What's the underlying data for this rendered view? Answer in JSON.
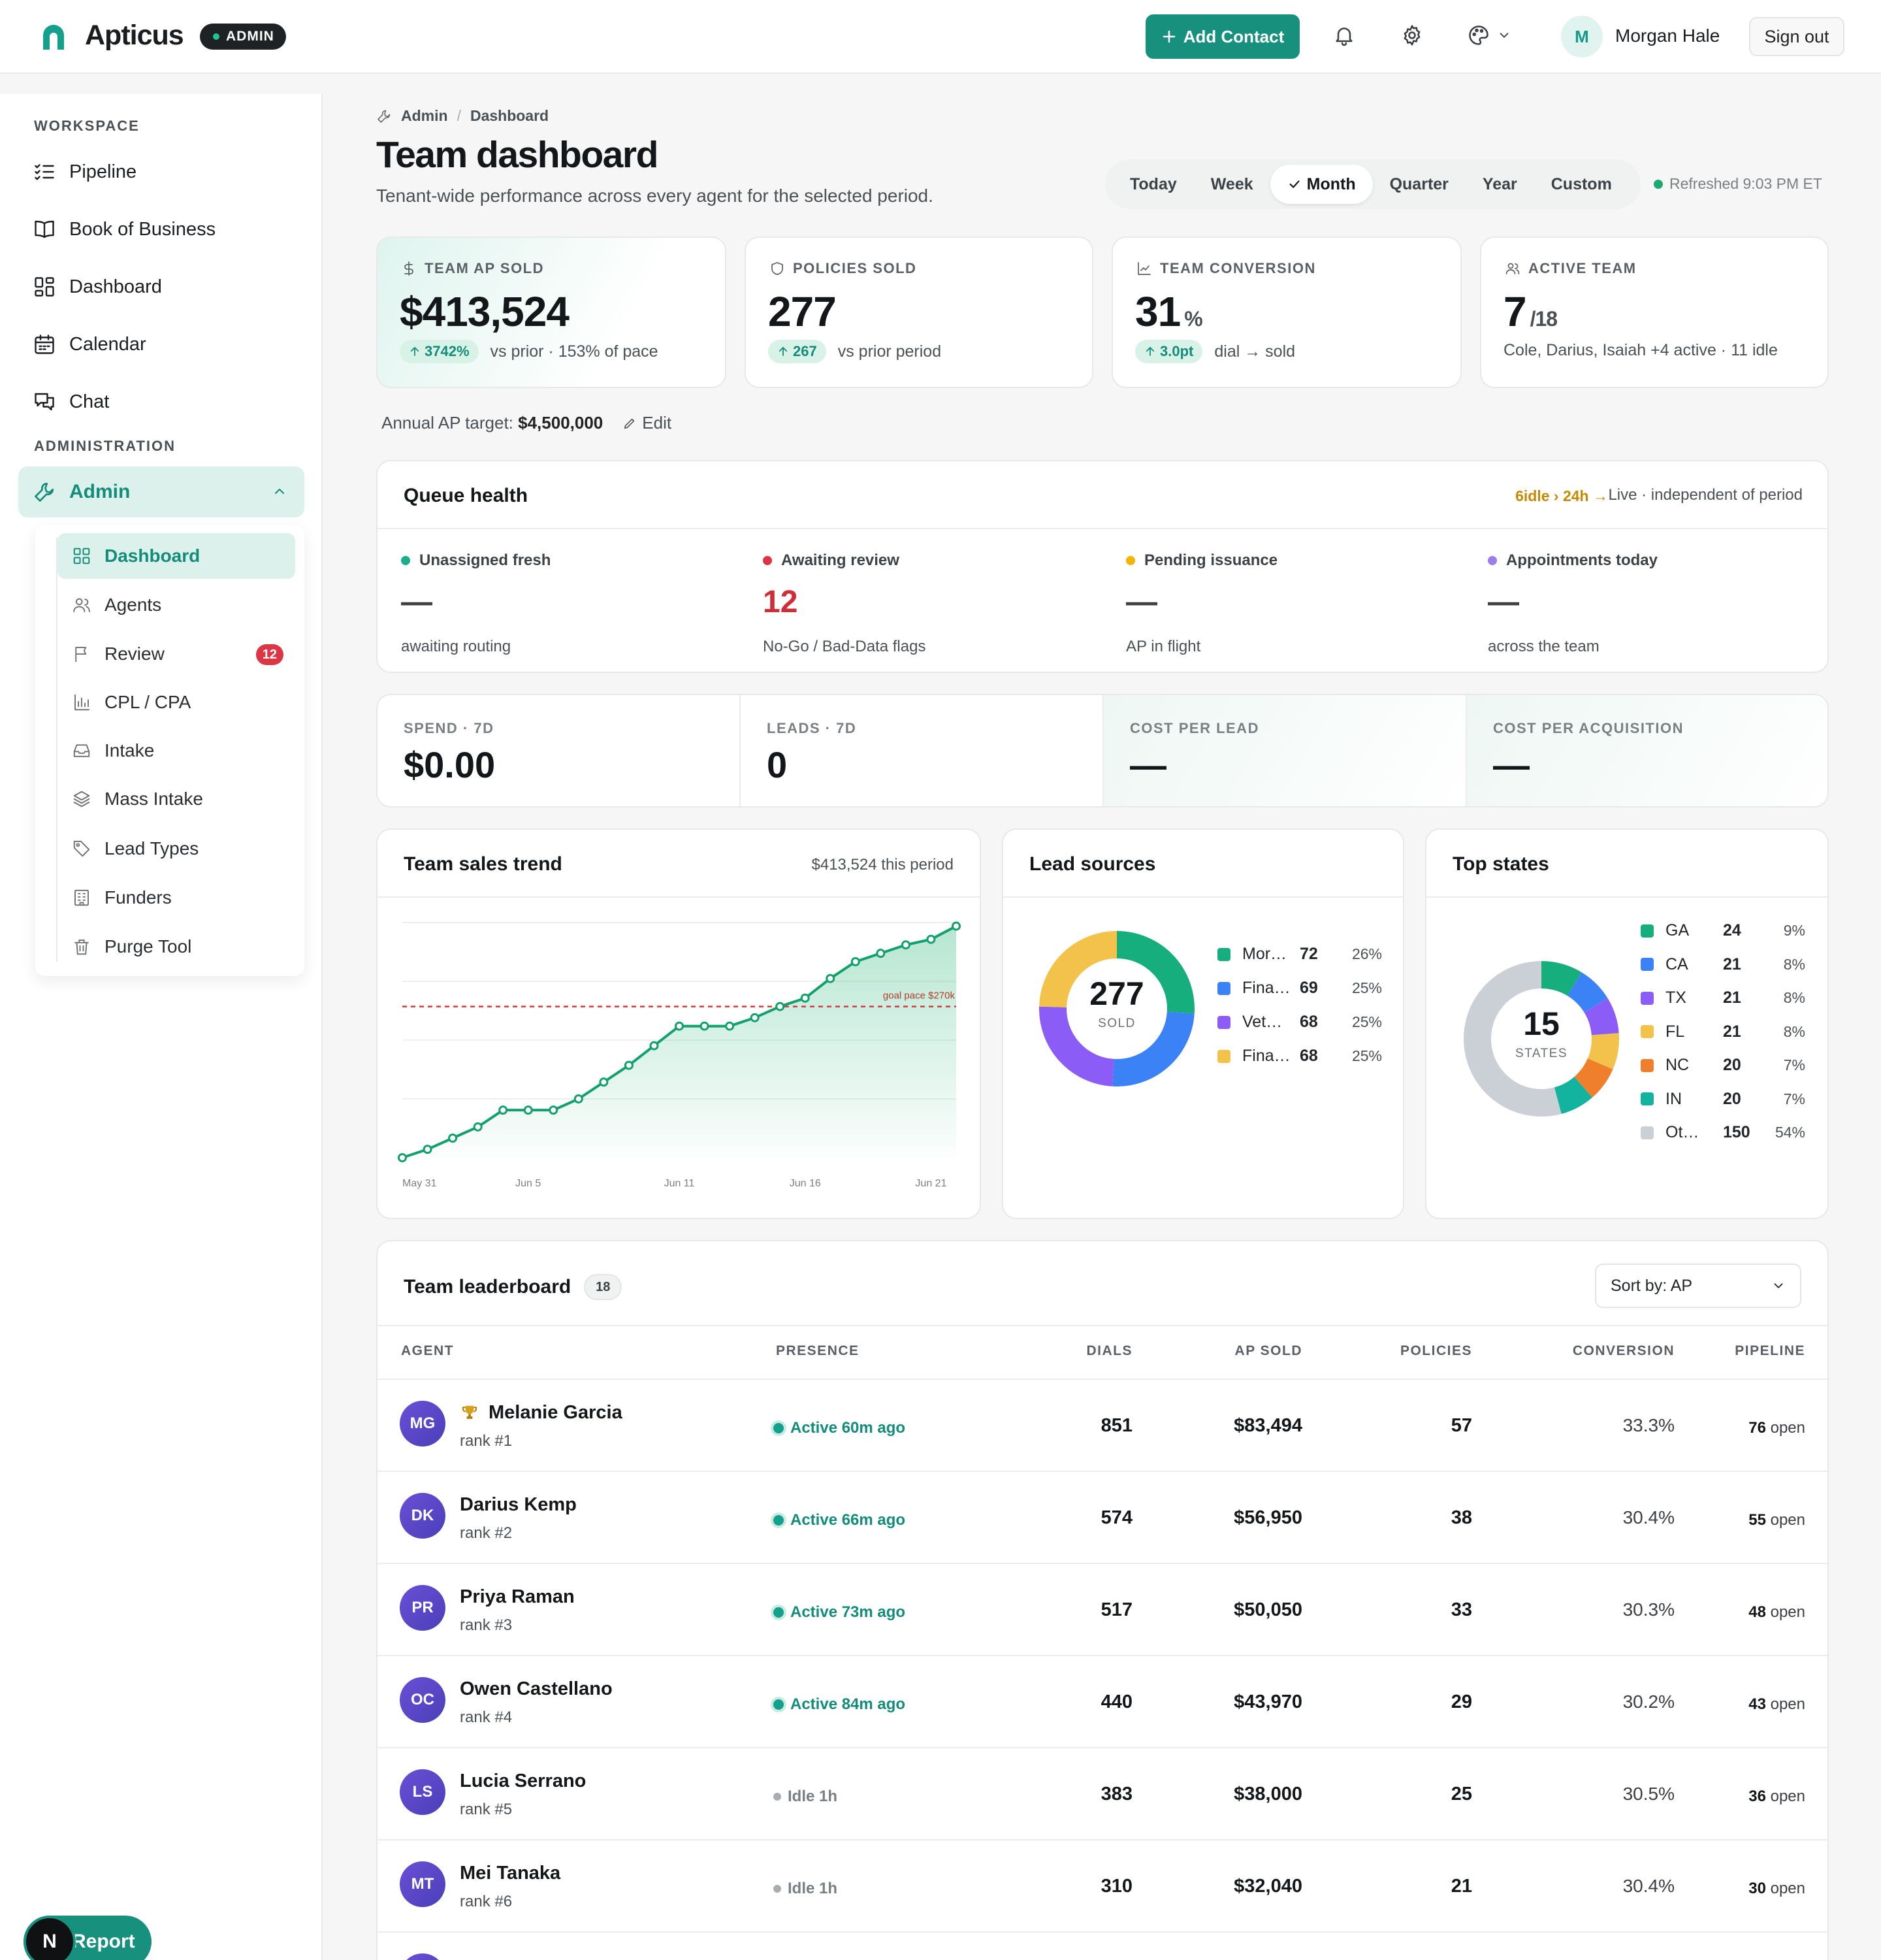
{
  "header": {
    "app_name": "Apticus",
    "role_badge": "ADMIN",
    "add_contact": "Add Contact",
    "user_initial": "M",
    "user_name": "Morgan Hale",
    "sign_out": "Sign out",
    "icons": [
      "bell-icon",
      "gear-icon",
      "palette-icon",
      "chevron-down-icon"
    ]
  },
  "sidebar": {
    "workspace_label": "WORKSPACE",
    "workspace_items": [
      {
        "label": "Pipeline",
        "icon": "list-check-icon"
      },
      {
        "label": "Book of Business",
        "icon": "book-icon"
      },
      {
        "label": "Dashboard",
        "icon": "grid-icon"
      },
      {
        "label": "Calendar",
        "icon": "calendar-icon"
      },
      {
        "label": "Chat",
        "icon": "chat-icon"
      }
    ],
    "admin_label": "ADMINISTRATION",
    "admin_item": "Admin",
    "admin_items": [
      {
        "label": "Dashboard",
        "icon": "grid-icon",
        "active": true
      },
      {
        "label": "Agents",
        "icon": "users-icon"
      },
      {
        "label": "Review",
        "icon": "flag-icon",
        "badge": "12"
      },
      {
        "label": "CPL / CPA",
        "icon": "bar-chart-icon"
      },
      {
        "label": "Intake",
        "icon": "inbox-icon"
      },
      {
        "label": "Mass Intake",
        "icon": "layers-icon"
      },
      {
        "label": "Lead Types",
        "icon": "tag-icon"
      },
      {
        "label": "Funders",
        "icon": "building-icon"
      },
      {
        "label": "Purge Tool",
        "icon": "trash-icon"
      }
    ],
    "report_initial": "N",
    "report_label": "Report"
  },
  "page": {
    "breadcrumb": [
      "Admin",
      "Dashboard"
    ],
    "title": "Team dashboard",
    "subtitle": "Tenant-wide performance across every agent for the selected period.",
    "periods": [
      "Today",
      "Week",
      "Month",
      "Quarter",
      "Year",
      "Custom"
    ],
    "active_period": "Month",
    "refreshed": "Refreshed 9:03 PM ET"
  },
  "kpis": [
    {
      "label": "TEAM AP SOLD",
      "icon": "dollar-icon",
      "value": "$413,524",
      "delta": "3742%",
      "note": "vs prior · 153% of pace"
    },
    {
      "label": "POLICIES SOLD",
      "icon": "shield-icon",
      "value": "277",
      "delta": "267",
      "note": "vs prior period"
    },
    {
      "label": "TEAM CONVERSION",
      "icon": "line-chart-icon",
      "value": "31",
      "unit": "%",
      "delta": "3.0pt",
      "note": "dial → sold"
    },
    {
      "label": "ACTIVE TEAM",
      "icon": "users-icon",
      "value": "7",
      "unit": "/18",
      "note": "Cole, Darius, Isaiah +4 active · 11 idle"
    }
  ],
  "target": {
    "prefix": "Annual AP target:",
    "value": "$4,500,000",
    "edit": "Edit"
  },
  "queue": {
    "title": "Queue health",
    "warning": "6idle › 24h →",
    "live_note": "Live · independent of period",
    "items": [
      {
        "label": "Unassigned fresh",
        "dot": "#1aae8a",
        "value": "—",
        "sub": "awaiting routing"
      },
      {
        "label": "Awaiting review",
        "dot": "#dc3545",
        "value": "12",
        "value_color": "#cf2e38",
        "sub": "No-Go / Bad-Data flags"
      },
      {
        "label": "Pending issuance",
        "dot": "#f4b400",
        "value": "—",
        "sub": "AP in flight"
      },
      {
        "label": "Appointments today",
        "dot": "#9b7df0",
        "value": "—",
        "sub": "across the team"
      }
    ]
  },
  "spend": [
    {
      "label": "SPEND · 7D",
      "value": "$0.00"
    },
    {
      "label": "LEADS · 7D",
      "value": "0"
    },
    {
      "label": "COST PER LEAD",
      "value": "—"
    },
    {
      "label": "COST PER ACQUISITION",
      "value": "—"
    }
  ],
  "sales_trend": {
    "title": "Team sales trend",
    "total_note": "$413,524 this period",
    "goal_label": "goal pace $270k"
  },
  "lead_sources": {
    "title": "Lead sources",
    "center_value": "277",
    "center_label": "SOLD"
  },
  "top_states": {
    "title": "Top states",
    "center_value": "15",
    "center_label": "STATES"
  },
  "chart_data": [
    {
      "type": "area",
      "x": [
        "May 31",
        "Jun 1",
        "Jun 2",
        "Jun 3",
        "Jun 4",
        "Jun 5",
        "Jun 6",
        "Jun 7",
        "Jun 8",
        "Jun 9",
        "Jun 10",
        "Jun 11",
        "Jun 12",
        "Jun 13",
        "Jun 14",
        "Jun 15",
        "Jun 16",
        "Jun 17",
        "Jun 18",
        "Jun 19",
        "Jun 20",
        "Jun 21",
        "Jun 22"
      ],
      "x_tick_labels": [
        "May 31",
        "Jun 5",
        "Jun 11",
        "Jun 16",
        "Jun 21"
      ],
      "values": [
        0,
        15000,
        35000,
        55000,
        85000,
        85000,
        85000,
        105000,
        135000,
        165000,
        200000,
        235000,
        235000,
        235000,
        250000,
        270000,
        285000,
        320000,
        350000,
        365000,
        380000,
        390000,
        413524
      ],
      "goal": 270000,
      "ylim": [
        0,
        420000
      ],
      "colors": {
        "line": "#12a06e",
        "goal": "#d03a3a"
      }
    },
    {
      "type": "pie",
      "categories": [
        "Mor…",
        "Fina…",
        "Vet…",
        "Fina…"
      ],
      "values": [
        72,
        69,
        68,
        68
      ],
      "percent_labels": [
        "26%",
        "25%",
        "25%",
        "25%"
      ],
      "colors": [
        "#16ae7c",
        "#3b82f6",
        "#8b5cf6",
        "#f2c24a"
      ]
    },
    {
      "type": "pie",
      "categories": [
        "GA",
        "CA",
        "TX",
        "FL",
        "NC",
        "IN",
        "Ot…"
      ],
      "values": [
        24,
        21,
        21,
        21,
        20,
        20,
        150
      ],
      "percent_labels": [
        "9%",
        "8%",
        "8%",
        "8%",
        "7%",
        "7%",
        "54%"
      ],
      "colors": [
        "#16ae7c",
        "#3b82f6",
        "#8b5cf6",
        "#f2c24a",
        "#f07f2c",
        "#13b3a0",
        "#cbcfd6"
      ]
    }
  ],
  "leaderboard": {
    "title": "Team leaderboard",
    "count": "18",
    "sort_label": "Sort by: AP",
    "columns": [
      "AGENT",
      "PRESENCE",
      "DIALS",
      "AP SOLD",
      "POLICIES",
      "CONVERSION",
      "PIPELINE"
    ],
    "pipeline_suffix": "open",
    "rows": [
      {
        "initials": "MG",
        "name": "Melanie Garcia",
        "rank": "rank #1",
        "trophy": true,
        "presence": "Active 60m ago",
        "status": "active",
        "dials": "851",
        "ap": "$83,494",
        "policies": "57",
        "conversion": "33.3%",
        "pipeline": "76"
      },
      {
        "initials": "DK",
        "name": "Darius Kemp",
        "rank": "rank #2",
        "presence": "Active 66m ago",
        "status": "active",
        "dials": "574",
        "ap": "$56,950",
        "policies": "38",
        "conversion": "30.4%",
        "pipeline": "55"
      },
      {
        "initials": "PR",
        "name": "Priya Raman",
        "rank": "rank #3",
        "presence": "Active 73m ago",
        "status": "active",
        "dials": "517",
        "ap": "$50,050",
        "policies": "33",
        "conversion": "30.3%",
        "pipeline": "48"
      },
      {
        "initials": "OC",
        "name": "Owen Castellano",
        "rank": "rank #4",
        "presence": "Active 84m ago",
        "status": "active",
        "dials": "440",
        "ap": "$43,970",
        "policies": "29",
        "conversion": "30.2%",
        "pipeline": "43"
      },
      {
        "initials": "LS",
        "name": "Lucia Serrano",
        "rank": "rank #5",
        "presence": "Idle 1h",
        "status": "idle",
        "dials": "383",
        "ap": "$38,000",
        "policies": "25",
        "conversion": "30.5%",
        "pipeline": "36"
      },
      {
        "initials": "MT",
        "name": "Mei Tanaka",
        "rank": "rank #6",
        "presence": "Idle 1h",
        "status": "idle",
        "dials": "310",
        "ap": "$32,040",
        "policies": "21",
        "conversion": "30.4%",
        "pipeline": "30"
      }
    ]
  }
}
